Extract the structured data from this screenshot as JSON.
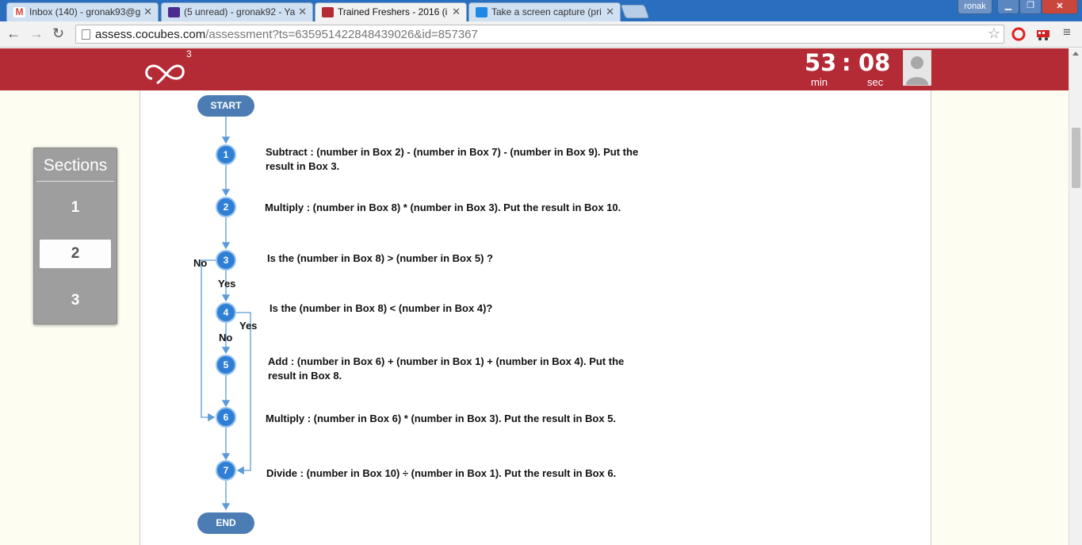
{
  "browser": {
    "tabs": [
      {
        "label": "Inbox (140) - gronak93@g",
        "icon_color": "#d44638"
      },
      {
        "label": "(5 unread) - gronak92 - Ya",
        "icon_color": "#4a2d8f"
      },
      {
        "label": "Trained Freshers - 2016 (i",
        "icon_color": "#b42a35"
      },
      {
        "label": "Take a screen capture (pri",
        "icon_color": "#1e88e5"
      }
    ],
    "profile": "ronak",
    "url_host": "assess.cocubes.com",
    "url_path": "/assessment?ts=635951422848439026&id=857367"
  },
  "header": {
    "logo_sup": "3",
    "timer": {
      "minutes": "53",
      "sep": ":",
      "seconds": "08",
      "min_label": "min",
      "sec_label": "sec"
    }
  },
  "sections": {
    "title": "Sections",
    "items": [
      "1",
      "2",
      "3"
    ],
    "active": "2"
  },
  "flowchart": {
    "start": "START",
    "end": "END",
    "nodes": [
      "1",
      "2",
      "3",
      "4",
      "5",
      "6",
      "7"
    ],
    "steps": [
      "Subtract : (number in Box 2) - (number in Box 7) - (number in Box 9). Put the result in Box 3.",
      "Multiply : (number in Box 8) * (number in Box 3). Put the result in Box 10.",
      "Is the (number in Box 8) >  (number in Box 5) ?",
      "Is the (number in Box 8) <  (number in Box 4)?",
      "Add : (number in Box 6) + (number in Box 1) + (number in Box 4). Put the result in Box 8.",
      "Multiply : (number in Box 6)  * (number in Box 3). Put the result in Box 5.",
      "Divide : (number in Box 10) ÷ (number in Box 1). Put the result in Box 6."
    ],
    "labels": {
      "no3": "No",
      "yes3": "Yes",
      "yes4": "Yes",
      "no4": "No"
    },
    "arrow_color": "#5a9bd8"
  }
}
